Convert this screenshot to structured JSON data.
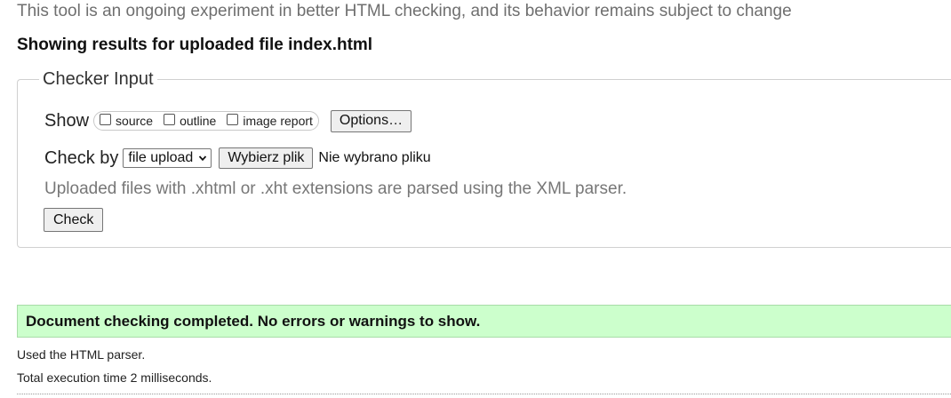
{
  "tagline": "This tool is an ongoing experiment in better HTML checking, and its behavior remains subject to change",
  "results_heading": "Showing results for uploaded file index.html",
  "checker_input": {
    "legend": "Checker Input",
    "show": {
      "label": "Show",
      "options": [
        {
          "label": "source",
          "checked": false
        },
        {
          "label": "outline",
          "checked": false
        },
        {
          "label": "image report",
          "checked": false
        }
      ],
      "options_button": "Options…"
    },
    "check_by": {
      "label": "Check by",
      "selected": "file upload",
      "file_button": "Wybierz plik",
      "no_file_text": "Nie wybrano pliku"
    },
    "note": "Uploaded files with .xhtml or .xht extensions are parsed using the XML parser.",
    "check_button": "Check"
  },
  "result": {
    "message": "Document checking completed. No errors or warnings to show.",
    "parser_info": "Used the HTML parser.",
    "execution_time": "Total execution time 2 milliseconds."
  },
  "colors": {
    "success_background": "#ccffcc",
    "muted_text": "#777777"
  }
}
